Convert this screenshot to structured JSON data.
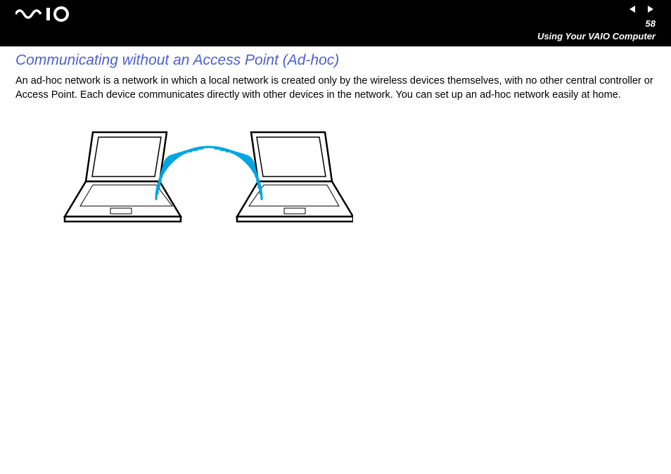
{
  "header": {
    "page_number": "58",
    "section": "Using Your VAIO Computer"
  },
  "content": {
    "heading": "Communicating without an Access Point (Ad-hoc)",
    "paragraph": "An ad-hoc network is a network in which a local network is created only by the wireless devices themselves, with no other central controller or Access Point. Each device communicates directly with other devices in the network. You can set up an ad-hoc network easily at home."
  }
}
